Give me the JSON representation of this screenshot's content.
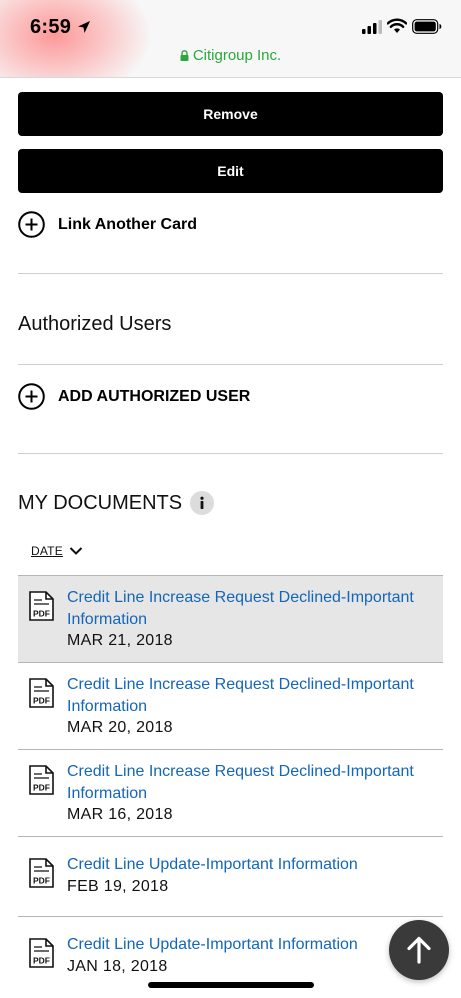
{
  "status_bar": {
    "time": "6:59",
    "domain": "Citigroup Inc."
  },
  "actions": {
    "remove_label": "Remove",
    "edit_label": "Edit",
    "link_card_label": "Link Another Card"
  },
  "authorized_users": {
    "title": "Authorized Users",
    "add_label": "ADD AUTHORIZED USER"
  },
  "documents": {
    "title": "MY DOCUMENTS",
    "sort_label": "DATE",
    "items": [
      {
        "title": "Credit Line Increase Request Declined-Important Information",
        "date": "MAR 21, 2018"
      },
      {
        "title": "Credit Line Increase Request Declined-Important Information",
        "date": "MAR 20, 2018"
      },
      {
        "title": "Credit Line Increase Request Declined-Important Information",
        "date": "MAR 16, 2018"
      },
      {
        "title": "Credit Line Update-Important Information",
        "date": "FEB 19, 2018"
      },
      {
        "title": "Credit Line Update-Important Information",
        "date": "JAN 18, 2018"
      }
    ]
  },
  "colors": {
    "button_bg": "#000000",
    "link": "#1466b8",
    "secure_green": "#2aa83b",
    "selected_row": "#e6e6e6"
  },
  "icons": [
    "location-arrow-icon",
    "signal-icon",
    "wifi-icon",
    "battery-icon",
    "lock-icon",
    "plus-circle-icon",
    "info-icon",
    "chevron-down-icon",
    "pdf-icon",
    "arrow-up-icon"
  ]
}
